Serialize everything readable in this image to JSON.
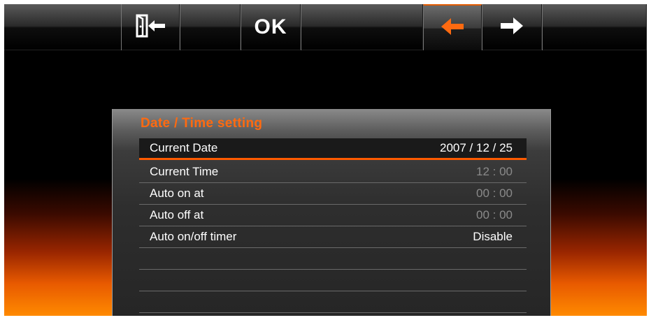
{
  "toolbar": {
    "back_icon": "exit-door-arrow-icon",
    "ok_label": "OK",
    "prev_icon": "arrow-left-icon",
    "next_icon": "arrow-right-icon",
    "accent_color": "#ff5a00"
  },
  "panel": {
    "title": "Date / Time setting",
    "rows": [
      {
        "label": "Current Date",
        "value": "2007 / 12 / 25"
      },
      {
        "label": "Current Time",
        "value": "12 : 00"
      },
      {
        "label": "Auto on at",
        "value": "00 : 00"
      },
      {
        "label": "Auto off at",
        "value": "00 : 00"
      },
      {
        "label": "Auto on/off timer",
        "value": "Disable"
      },
      {
        "label": "",
        "value": ""
      },
      {
        "label": "",
        "value": ""
      },
      {
        "label": "",
        "value": ""
      }
    ]
  }
}
